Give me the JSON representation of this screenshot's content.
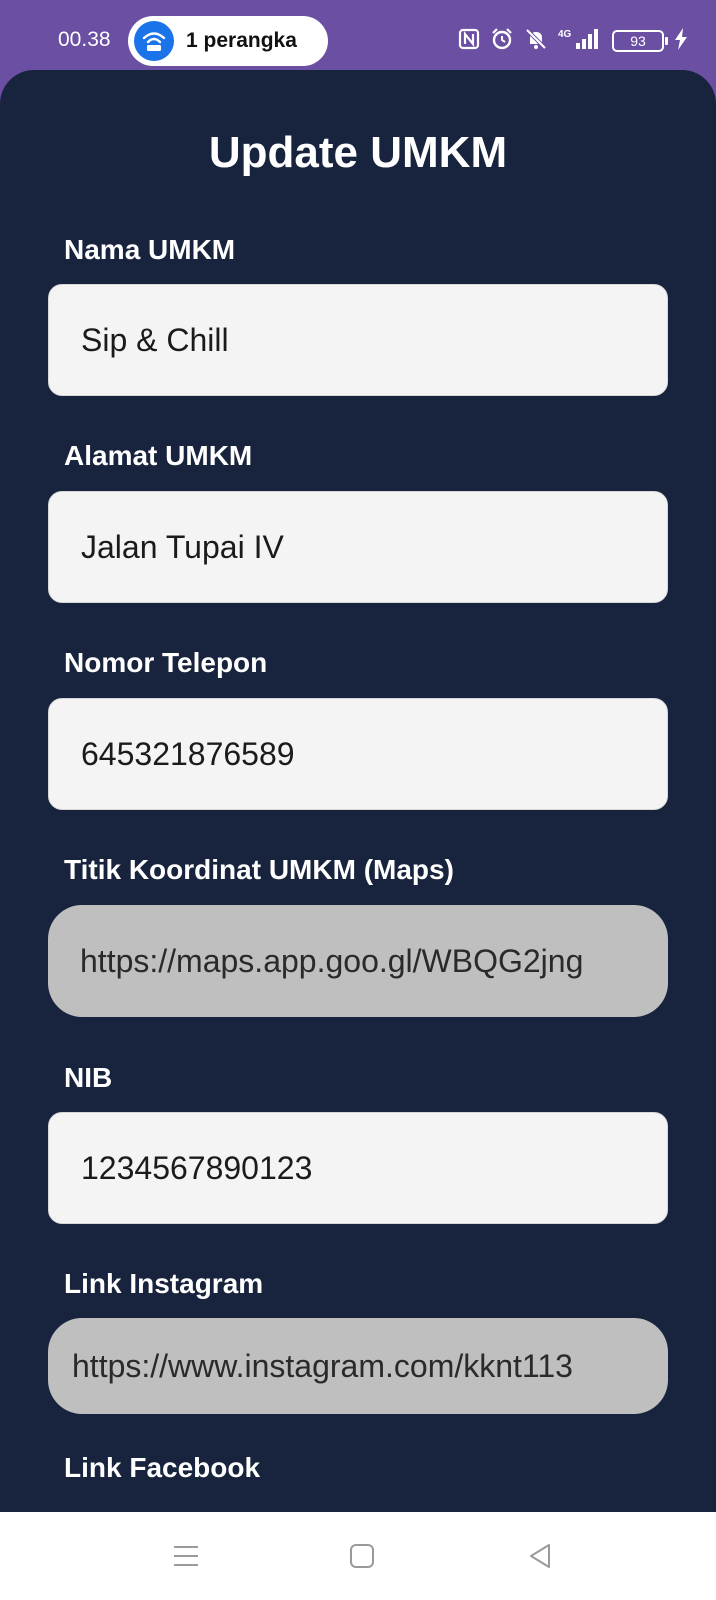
{
  "status_bar": {
    "time": "00.38",
    "hotspot_label": "1 perangka",
    "network": "4G",
    "battery": "93"
  },
  "page": {
    "title": "Update UMKM"
  },
  "form": {
    "fields": [
      {
        "label": "Nama UMKM",
        "value": "Sip & Chill"
      },
      {
        "label": "Alamat UMKM",
        "value": "Jalan Tupai IV"
      },
      {
        "label": "Nomor Telepon",
        "value": "645321876589"
      },
      {
        "label": "Titik Koordinat UMKM (Maps)",
        "value": "https://maps.app.goo.gl/WBQG2jng"
      },
      {
        "label": "NIB",
        "value": "1234567890123"
      },
      {
        "label": "Link Instagram",
        "value": "https://www.instagram.com/kknt113"
      },
      {
        "label": "Link Facebook",
        "value": ""
      }
    ]
  },
  "colors": {
    "status_bar": "#6a4fa3",
    "card_background": "#18233d",
    "input_background": "#f4f4f4",
    "disabled_input_background": "#bfbfbf",
    "hotspot_accent": "#1a73e8"
  },
  "icons": {
    "hotspot": "wifi-hotspot-icon",
    "nfc": "nfc-icon",
    "alarm": "alarm-icon",
    "mute": "bell-off-icon",
    "signal": "signal-icon",
    "charging": "lightning-icon",
    "nav_menu": "menu-icon",
    "nav_home": "home-square-icon",
    "nav_back": "back-triangle-icon"
  }
}
